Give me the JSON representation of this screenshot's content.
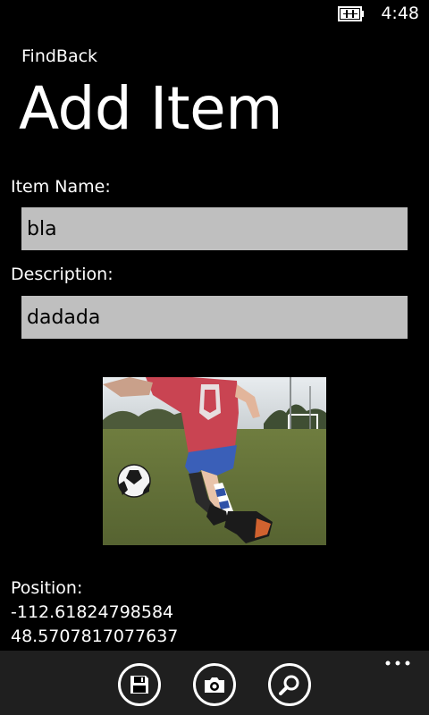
{
  "status_bar": {
    "time": "4:48",
    "battery_icon": "battery-charging-icon"
  },
  "app": {
    "name": "FindBack"
  },
  "page": {
    "title": "Add Item"
  },
  "form": {
    "item_name_label": "Item Name:",
    "item_name_value": "bla",
    "description_label": "Description:",
    "description_value": "dadada"
  },
  "photo": {
    "subject": "child kicking soccer ball on field"
  },
  "position": {
    "label": "Position:",
    "longitude": "-112.61824798584",
    "latitude": "48.5707817077637"
  },
  "app_bar": {
    "buttons": [
      {
        "icon": "save-icon"
      },
      {
        "icon": "camera-icon"
      },
      {
        "icon": "search-icon"
      }
    ],
    "more_icon": "more-dots-icon"
  },
  "colors": {
    "background": "#000000",
    "field_background": "#bfbfbf",
    "app_bar": "#1f1f1f"
  }
}
